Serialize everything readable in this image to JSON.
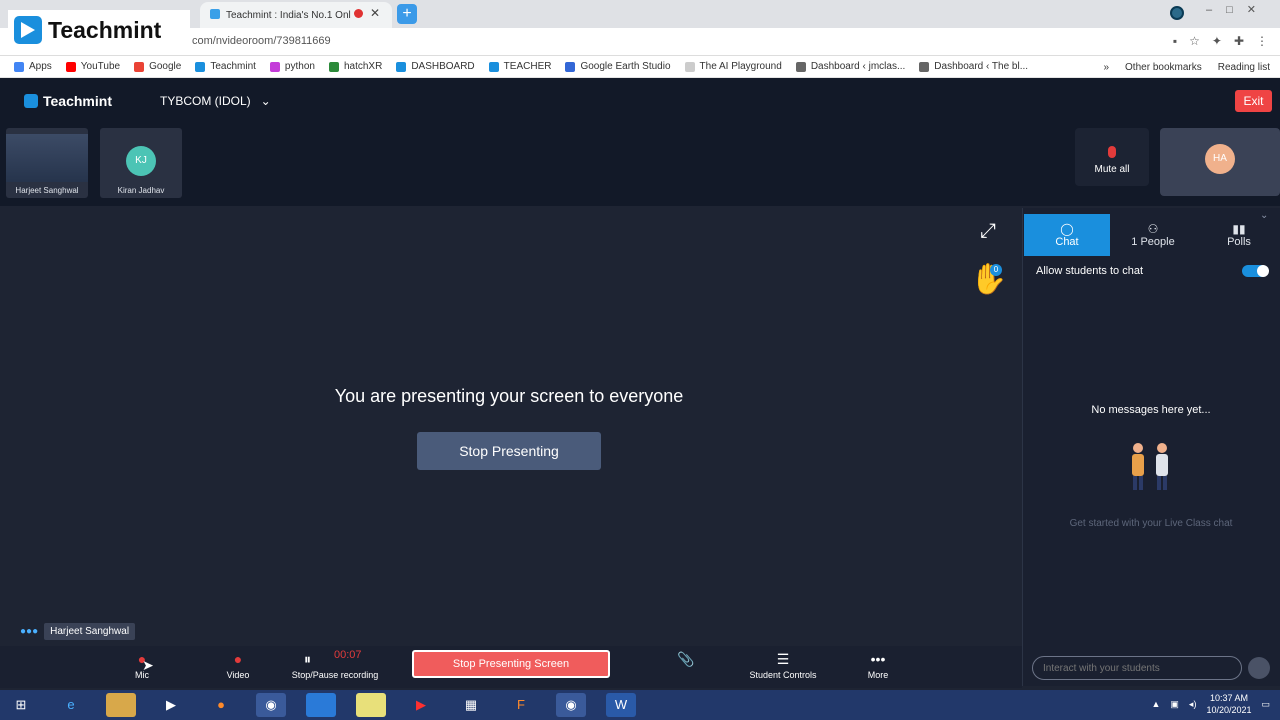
{
  "browser": {
    "tab_title": "Teachmint : India's No.1 Onl",
    "url": "com/nvideoroom/739811669",
    "bookmarks": [
      "Apps",
      "YouTube",
      "Google",
      "Teachmint",
      "python",
      "hatchXR",
      "DASHBOARD",
      "TEACHER",
      "Google Earth Studio",
      "The AI Playground",
      "Dashboard ‹ jmclas...",
      "Dashboard ‹ The bl..."
    ],
    "other_bookmarks": "Other bookmarks",
    "reading_list": "Reading list"
  },
  "logo_overlay": {
    "text": "Teachmint"
  },
  "header": {
    "app_name": "Teachmint",
    "class_name": "TYBCOM (IDOL)",
    "exit_label": "Exit"
  },
  "participants": [
    {
      "name": "Harjeet Sanghwal"
    },
    {
      "name": "Kiran Jadhav",
      "initials": "KJ"
    }
  ],
  "mute_all_label": "Mute all",
  "self_initials": "HA",
  "stage": {
    "presenting_message": "You are presenting your screen to everyone",
    "stop_presenting_label": "Stop Presenting",
    "hand_count": "0",
    "speaker_name": "Harjeet Sanghwal"
  },
  "panel": {
    "tabs": [
      {
        "label": "Chat"
      },
      {
        "label": "1 People"
      },
      {
        "label": "Polls"
      }
    ],
    "allow_chat_label": "Allow students to chat",
    "no_messages": "No messages here yet...",
    "get_started": "Get started with your Live Class chat",
    "input_placeholder": "Interact with your students"
  },
  "toolbar": {
    "mic": "Mic",
    "video": "Video",
    "record": "Stop/Pause recording",
    "record_time": "00:07",
    "stop_screen": "Stop Presenting Screen",
    "student_controls": "Student Controls",
    "more": "More"
  },
  "taskbar": {
    "time": "10:37 AM",
    "date": "10/20/2021"
  },
  "colors": {
    "accent": "#1a8fdd",
    "danger": "#ef4444",
    "background": "#1e2433"
  }
}
